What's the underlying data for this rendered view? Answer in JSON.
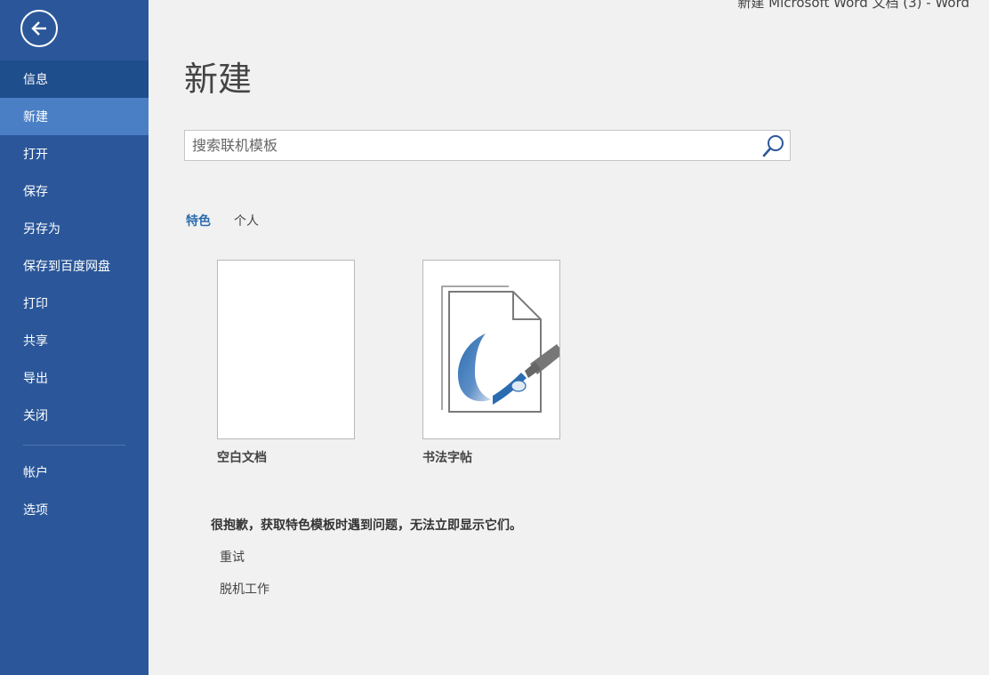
{
  "window_title": "新建 Microsoft Word 文档 (3) - Word",
  "sidebar": {
    "items": [
      {
        "label": "信息"
      },
      {
        "label": "新建"
      },
      {
        "label": "打开"
      },
      {
        "label": "保存"
      },
      {
        "label": "另存为"
      },
      {
        "label": "保存到百度网盘"
      },
      {
        "label": "打印"
      },
      {
        "label": "共享"
      },
      {
        "label": "导出"
      },
      {
        "label": "关闭"
      }
    ],
    "bottom_items": [
      {
        "label": "帐户"
      },
      {
        "label": "选项"
      }
    ],
    "back_icon": "arrow-left-circle-icon"
  },
  "main": {
    "title": "新建",
    "search": {
      "placeholder": "搜索联机模板",
      "value": ""
    },
    "tabs": [
      {
        "label": "特色",
        "active": true
      },
      {
        "label": "个人",
        "active": false
      }
    ],
    "templates": [
      {
        "label": "空白文档"
      },
      {
        "label": "书法字帖"
      }
    ],
    "error_message": "很抱歉，获取特色模板时遇到问题，无法立即显示它们。",
    "actions": {
      "retry": "重试",
      "offline": "脱机工作"
    }
  },
  "colors": {
    "sidebar_bg": "#2b579a",
    "sidebar_active": "#4a7fc6",
    "accent": "#2b6cb0",
    "page_bg": "#f1f1f1"
  }
}
